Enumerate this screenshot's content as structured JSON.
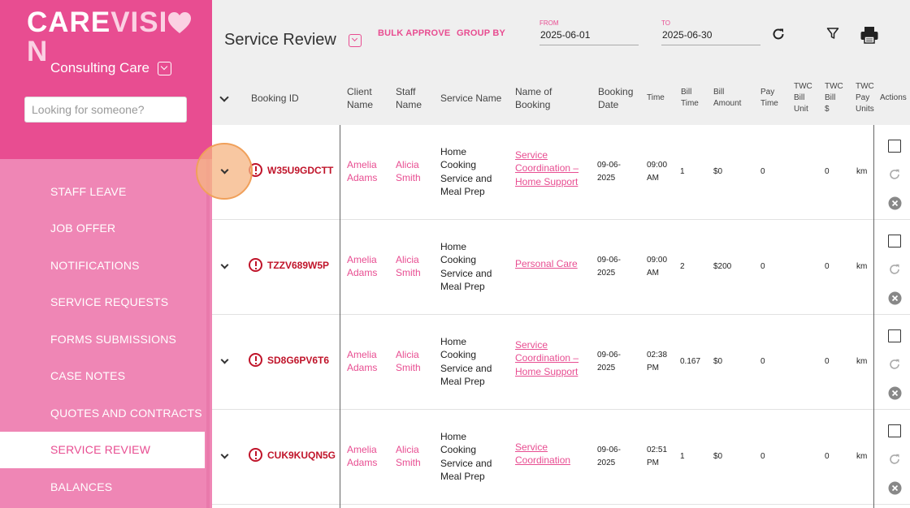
{
  "sidebar": {
    "logo_a": "CARE",
    "logo_b": "VISI",
    "logo_c": "N",
    "org_name": "Consulting Care",
    "search_placeholder": "Looking for someone?",
    "items": [
      {
        "label": "STAFF LEAVE",
        "active": false
      },
      {
        "label": "JOB OFFER",
        "active": false
      },
      {
        "label": "NOTIFICATIONS",
        "active": false
      },
      {
        "label": "SERVICE REQUESTS",
        "active": false
      },
      {
        "label": "FORMS SUBMISSIONS",
        "active": false
      },
      {
        "label": "CASE NOTES",
        "active": false
      },
      {
        "label": "QUOTES AND CONTRACTS",
        "active": false
      },
      {
        "label": "SERVICE REVIEW",
        "active": true
      },
      {
        "label": "BALANCES",
        "active": false
      }
    ]
  },
  "header": {
    "title": "Service Review",
    "bulk_approve": "BULK APPROVE",
    "group_by": "GROUP BY",
    "from_label": "FROM",
    "from_value": "2025-06-01",
    "to_label": "TO",
    "to_value": "2025-06-30"
  },
  "columns": {
    "booking_id": "Booking ID",
    "client_name": [
      "Client",
      "Name"
    ],
    "staff_name": [
      "Staff",
      "Name"
    ],
    "service_name": "Service Name",
    "name_of_booking": [
      "Name of",
      "Booking"
    ],
    "booking_date": [
      "Booking",
      "Date"
    ],
    "time": "Time",
    "bill_time": [
      "Bill",
      "Time"
    ],
    "bill_amount": [
      "Bill",
      "Amount"
    ],
    "pay_time": [
      "Pay",
      "Time"
    ],
    "twc_bill_unit": [
      "TWC",
      "Bill",
      "Unit"
    ],
    "twc_bill_dollar": [
      "TWC",
      "Bill",
      "$"
    ],
    "twc_pay_units": [
      "TWC",
      "Pay",
      "Units"
    ],
    "actions": "Actions"
  },
  "rows": [
    {
      "booking_id": "W35U9GDCTT",
      "client": [
        "Amelia",
        "Adams"
      ],
      "staff": [
        "Alicia",
        "Smith"
      ],
      "service": [
        "Home",
        "Cooking",
        "Service and",
        "Meal Prep"
      ],
      "booking_name": [
        "Service",
        "Coordination –",
        "Home Support"
      ],
      "date": [
        "09-06-",
        "2025"
      ],
      "time": [
        "09:00",
        "AM"
      ],
      "bill_time": "1",
      "bill_amount": "$0",
      "pay_time": "0",
      "twc_bill_dollar": "0",
      "twc_pay_units": "km"
    },
    {
      "booking_id": "TZZV689W5P",
      "client": [
        "Amelia",
        "Adams"
      ],
      "staff": [
        "Alicia",
        "Smith"
      ],
      "service": [
        "Home",
        "Cooking",
        "Service and",
        "Meal Prep"
      ],
      "booking_name": [
        "Personal Care"
      ],
      "date": [
        "09-06-",
        "2025"
      ],
      "time": [
        "09:00",
        "AM"
      ],
      "bill_time": "2",
      "bill_amount": "$200",
      "pay_time": "0",
      "twc_bill_dollar": "0",
      "twc_pay_units": "km"
    },
    {
      "booking_id": "SD8G6PV6T6",
      "client": [
        "Amelia",
        "Adams"
      ],
      "staff": [
        "Alicia",
        "Smith"
      ],
      "service": [
        "Home",
        "Cooking",
        "Service and",
        "Meal Prep"
      ],
      "booking_name": [
        "Service",
        "Coordination –",
        "Home Support"
      ],
      "date": [
        "09-06-",
        "2025"
      ],
      "time": [
        "02:38",
        "PM"
      ],
      "bill_time": "0.167",
      "bill_amount": "$0",
      "pay_time": "0",
      "twc_bill_dollar": "0",
      "twc_pay_units": "km"
    },
    {
      "booking_id": "CUK9KUQN5G",
      "client": [
        "Amelia",
        "Adams"
      ],
      "staff": [
        "Alicia",
        "Smith"
      ],
      "service": [
        "Home",
        "Cooking",
        "Service and",
        "Meal Prep"
      ],
      "booking_name": [
        "Service",
        "Coordination"
      ],
      "date": [
        "09-06-",
        "2025"
      ],
      "time": [
        "02:51",
        "PM"
      ],
      "bill_time": "1",
      "bill_amount": "$0",
      "pay_time": "0",
      "twc_bill_dollar": "0",
      "twc_pay_units": "km"
    }
  ]
}
